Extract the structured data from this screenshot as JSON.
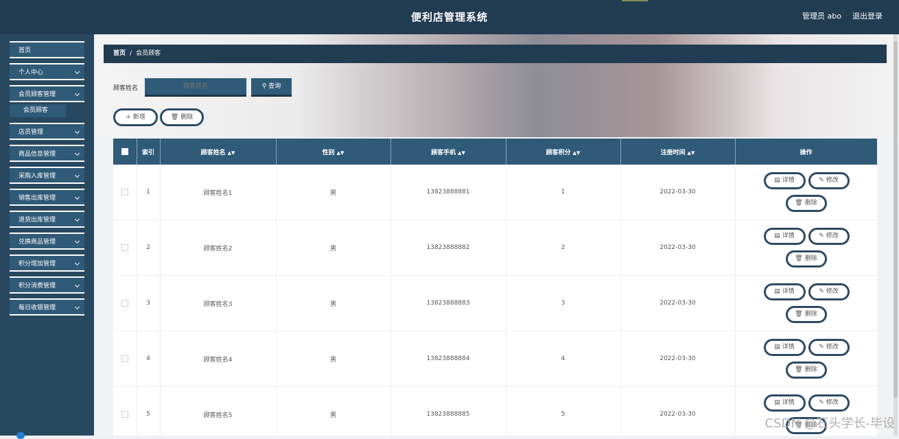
{
  "header": {
    "title": "便利店管理系统",
    "user": "管理员 abo",
    "logout": "退出登录"
  },
  "sidebar": {
    "items": [
      {
        "label": "首页",
        "expandable": false
      },
      {
        "label": "个人中心",
        "expandable": true
      },
      {
        "label": "会员顾客管理",
        "expandable": true,
        "sub": [
          "会员顾客"
        ]
      },
      {
        "label": "店员管理",
        "expandable": true
      },
      {
        "label": "商品信息管理",
        "expandable": true
      },
      {
        "label": "采购入库管理",
        "expandable": true
      },
      {
        "label": "销售出库管理",
        "expandable": true
      },
      {
        "label": "退货出库管理",
        "expandable": true
      },
      {
        "label": "兑换商品管理",
        "expandable": true
      },
      {
        "label": "积分增加管理",
        "expandable": true
      },
      {
        "label": "积分消费管理",
        "expandable": true
      },
      {
        "label": "每日收银管理",
        "expandable": true
      }
    ]
  },
  "breadcrumb": {
    "home": "首页",
    "separator": "/",
    "current": "会员顾客"
  },
  "search": {
    "label": "顾客姓名",
    "placeholder": "顾客姓名",
    "button": "查询"
  },
  "actions": {
    "add": "新增",
    "delete": "删除"
  },
  "table": {
    "headers": [
      "索引",
      "顾客姓名",
      "性别",
      "顾客手机",
      "顾客积分",
      "注册时间",
      "操作"
    ],
    "sortable": [
      false,
      true,
      true,
      true,
      true,
      true,
      false
    ],
    "rows": [
      {
        "index": "1",
        "name": "顾客姓名1",
        "gender": "男",
        "phone": "13823888881",
        "points": "1",
        "date": "2022-03-30"
      },
      {
        "index": "2",
        "name": "顾客姓名2",
        "gender": "男",
        "phone": "13823888882",
        "points": "2",
        "date": "2022-03-30"
      },
      {
        "index": "3",
        "name": "顾客姓名3",
        "gender": "男",
        "phone": "13823888883",
        "points": "3",
        "date": "2022-03-30"
      },
      {
        "index": "4",
        "name": "顾客姓名4",
        "gender": "男",
        "phone": "13823888884",
        "points": "4",
        "date": "2022-03-30"
      },
      {
        "index": "5",
        "name": "顾客姓名5",
        "gender": "男",
        "phone": "13823888885",
        "points": "5",
        "date": "2022-03-30"
      }
    ],
    "row_actions": {
      "detail": "详情",
      "edit": "修改",
      "remove": "删除"
    }
  },
  "watermark": "CSDN @石头学长-毕设",
  "colors": {
    "header_bg": "#223c52",
    "sidebar_bg": "#284860",
    "accent": "#2f5a78",
    "button_border": "#2c4a63"
  },
  "icons": {
    "search": "search-icon",
    "add": "plus-icon",
    "delete": "trash-icon",
    "detail": "document-icon",
    "edit": "pencil-icon",
    "expand": "chevron-down-icon"
  }
}
